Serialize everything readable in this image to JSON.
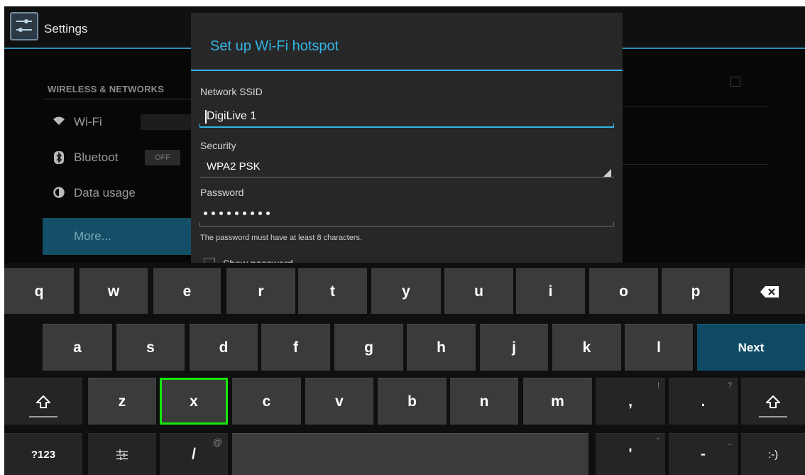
{
  "app": {
    "title": "Settings",
    "accent_color": "#33b5e5",
    "icon": "settings-sliders-icon"
  },
  "settings_list": {
    "section_header": "WIRELESS & NETWORKS",
    "items": [
      {
        "label": "Wi-Fi",
        "icon": "wifi-icon",
        "toggle": "on"
      },
      {
        "label": "Bluetoot",
        "icon": "bluetooth-icon",
        "toggle_label": "OFF"
      },
      {
        "label": "Data usage",
        "icon": "data-usage-icon"
      },
      {
        "label": "More...",
        "selected": true
      }
    ]
  },
  "dialog": {
    "title": "Set up Wi-Fi hotspot",
    "ssid_label": "Network SSID",
    "ssid_value": "DigiLive 1",
    "security_label": "Security",
    "security_value": "WPA2 PSK",
    "password_label": "Password",
    "password_masked_length": 9,
    "password_hint": "The password must have at least 8 characters.",
    "show_password_label": "Show password",
    "show_password_checked": false
  },
  "keyboard": {
    "row1": [
      "q",
      "w",
      "e",
      "r",
      "t",
      "y",
      "u",
      "i",
      "o",
      "p"
    ],
    "backspace_icon": "backspace-icon",
    "row2": [
      "a",
      "s",
      "d",
      "f",
      "g",
      "h",
      "j",
      "k",
      "l"
    ],
    "next_label": "Next",
    "shift_icon": "shift-icon",
    "row3": [
      "z",
      "x",
      "c",
      "v",
      "b",
      "n",
      "m",
      ",",
      "."
    ],
    "row3_alts": {
      ",": "!",
      ".": "?"
    },
    "symbols_label": "?123",
    "settings_icon": "keyboard-settings-icon",
    "slash_label": "/",
    "slash_alt": "@",
    "apostrophe_label": "'",
    "apostrophe_alt": "\"",
    "dash_label": "-",
    "dash_alt": "_",
    "smiley_label": ":-)",
    "highlighted_key": "x",
    "highlight_color": "#16e80a"
  }
}
